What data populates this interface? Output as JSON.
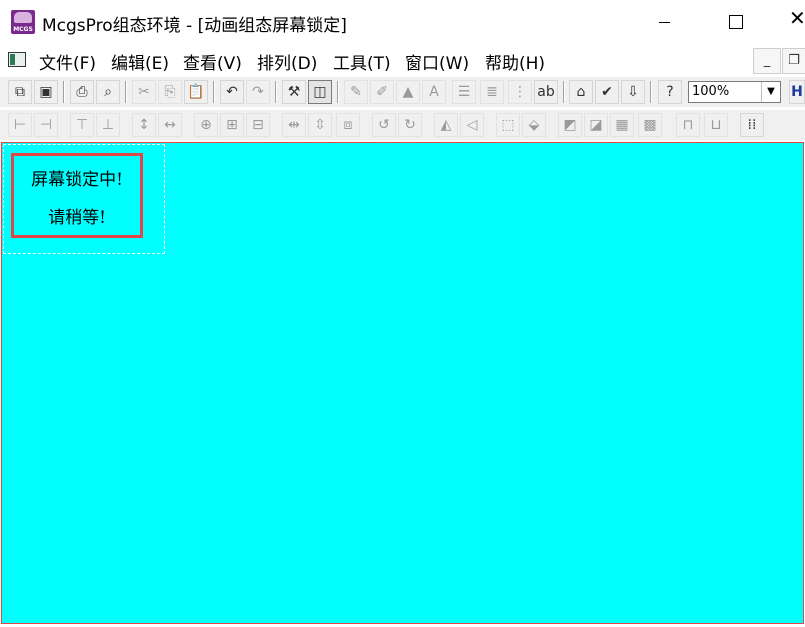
{
  "window": {
    "title": "McgsPro组态环境 - [动画组态屏幕锁定]",
    "icon": "mcgs-app-icon",
    "icon_text": "MCGS",
    "controls": {
      "minimize": "—",
      "maximize": "☐",
      "close": "✕"
    }
  },
  "menu": {
    "items": [
      {
        "label": "文件(F)"
      },
      {
        "label": "编辑(E)"
      },
      {
        "label": "查看(V)"
      },
      {
        "label": "排列(D)"
      },
      {
        "label": "工具(T)"
      },
      {
        "label": "窗口(W)"
      },
      {
        "label": "帮助(H)"
      }
    ],
    "mdi_minimize": "_",
    "mdi_restore": "❐"
  },
  "toolbar1": {
    "zoom_value": "100%",
    "icons": [
      "new-window-icon",
      "save-icon",
      "print-icon",
      "print-preview-icon",
      "cut-icon",
      "copy-icon",
      "paste-icon",
      "undo-icon",
      "redo-icon",
      "tools-icon",
      "layer-icon",
      "dynamic-icon",
      "animation-icon",
      "image-icon",
      "font-icon",
      "align-left-icon",
      "list-icon",
      "grid-icon",
      "abc-icon",
      "properties-icon",
      "check-icon",
      "sort-icon",
      "help-icon",
      "zoom-dropdown-icon"
    ]
  },
  "toolbar2": {
    "icons": [
      "align-left-edge-icon",
      "align-right-edge-icon",
      "align-top-edge-icon",
      "align-bottom-edge-icon",
      "equal-height-icon",
      "equal-width-icon",
      "center-both-icon",
      "center-vertical-icon",
      "center-horizontal-icon",
      "distribute-h-icon",
      "distribute-v-icon",
      "distribute-center-icon",
      "rotate-left-icon",
      "rotate-right-icon",
      "flip-h-icon",
      "flip-v-icon",
      "group-icon",
      "ungroup-icon",
      "bring-front-icon",
      "send-back-icon",
      "forward-icon",
      "backward-icon",
      "lock-icon",
      "unlock-icon",
      "grid-dots-icon"
    ]
  },
  "canvas": {
    "background": "#00FFFF",
    "lock_text_line1": "屏幕锁定中!",
    "lock_text_line2": "请稍等!"
  }
}
